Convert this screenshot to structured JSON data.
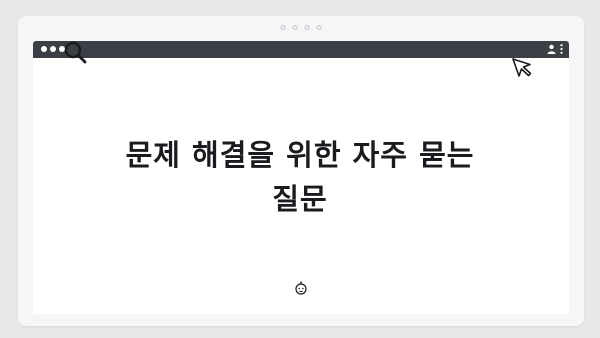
{
  "page": {
    "heading_line1": "문제 해결을 위한 자주 묻는",
    "heading_line2": "질문"
  },
  "icons": {
    "search": "search-icon",
    "cursor": "cursor-pointer-icon",
    "user": "user-icon",
    "menu": "more-vertical-icon",
    "baby": "baby-face-icon"
  },
  "colors": {
    "background": "#e7e8ea",
    "device": "#f5f6f7",
    "browser_bar": "#3b3f45",
    "content": "#ffffff",
    "text": "#1a1b1e"
  }
}
